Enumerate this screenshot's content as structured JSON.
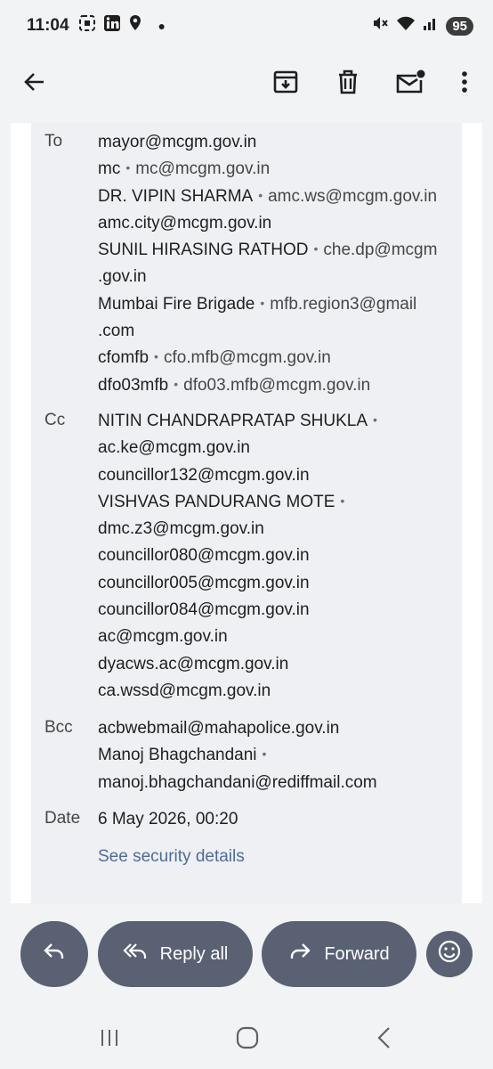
{
  "status_bar": {
    "time": "11:04",
    "battery": "95",
    "left_icons": [
      "screenshot-icon",
      "linkedin-icon",
      "location-icon",
      "dot-icon"
    ],
    "right_icons": [
      "mute-icon",
      "wifi-icon",
      "signal-icon"
    ]
  },
  "toolbar": {
    "icons": [
      "back-arrow-icon",
      "archive-icon",
      "delete-icon",
      "mark-unread-icon",
      "more-vert-icon"
    ]
  },
  "details": {
    "to": {
      "label": "To",
      "lines": [
        {
          "name": "",
          "email": "mayor@mcgm.gov.in"
        },
        {
          "name": "mc",
          "email": "mc@mcgm.gov.in"
        },
        {
          "name": "DR. VIPIN SHARMA",
          "email": "amc.ws@mcgm.gov.in"
        },
        {
          "name": "",
          "email": "amc.city@mcgm.gov.in"
        },
        {
          "name": "SUNIL HIRASING RATHOD",
          "email": "che.dp@mcgm"
        },
        {
          "name": "",
          "email": ".gov.in"
        },
        {
          "name": "Mumbai Fire Brigade",
          "email": "mfb.region3@gmail"
        },
        {
          "name": "",
          "email": ".com"
        },
        {
          "name": "cfomfb",
          "email": "cfo.mfb@mcgm.gov.in"
        },
        {
          "name": "dfo03mfb",
          "email": "dfo03.mfb@mcgm.gov.in"
        }
      ]
    },
    "cc": {
      "label": "Cc",
      "lines": [
        {
          "name": "NITIN CHANDRAPRATAP SHUKLA",
          "email": "",
          "trailing_dot": true
        },
        {
          "name": "",
          "email": "ac.ke@mcgm.gov.in"
        },
        {
          "name": "",
          "email": "councillor132@mcgm.gov.in"
        },
        {
          "name": "VISHVAS PANDURANG MOTE",
          "email": "",
          "trailing_dot": true
        },
        {
          "name": "",
          "email": "dmc.z3@mcgm.gov.in"
        },
        {
          "name": "",
          "email": "councillor080@mcgm.gov.in"
        },
        {
          "name": "",
          "email": "councillor005@mcgm.gov.in"
        },
        {
          "name": "",
          "email": "councillor084@mcgm.gov.in"
        },
        {
          "name": "",
          "email": "ac@mcgm.gov.in"
        },
        {
          "name": "",
          "email": "dyacws.ac@mcgm.gov.in"
        },
        {
          "name": "",
          "email": "ca.wssd@mcgm.gov.in"
        }
      ]
    },
    "bcc": {
      "label": "Bcc",
      "lines": [
        {
          "name": "",
          "email": "acbwebmail@mahapolice.gov.in"
        },
        {
          "name": "Manoj Bhagchandani",
          "email": "",
          "trailing_dot": true
        },
        {
          "name": "",
          "email": "manoj.bhagchandani@rediffmail.com"
        }
      ]
    },
    "date": {
      "label": "Date",
      "value": "6 May 2026, 00:20",
      "security_link": "See security details"
    }
  },
  "actions": {
    "reply_icon": "reply-icon",
    "reply_all_label": "Reply all",
    "forward_label": "Forward",
    "emoji_icon": "emoji-icon"
  },
  "colors": {
    "pill": "#596173",
    "link": "#4e6b9a",
    "background": "#f1f3f5"
  }
}
